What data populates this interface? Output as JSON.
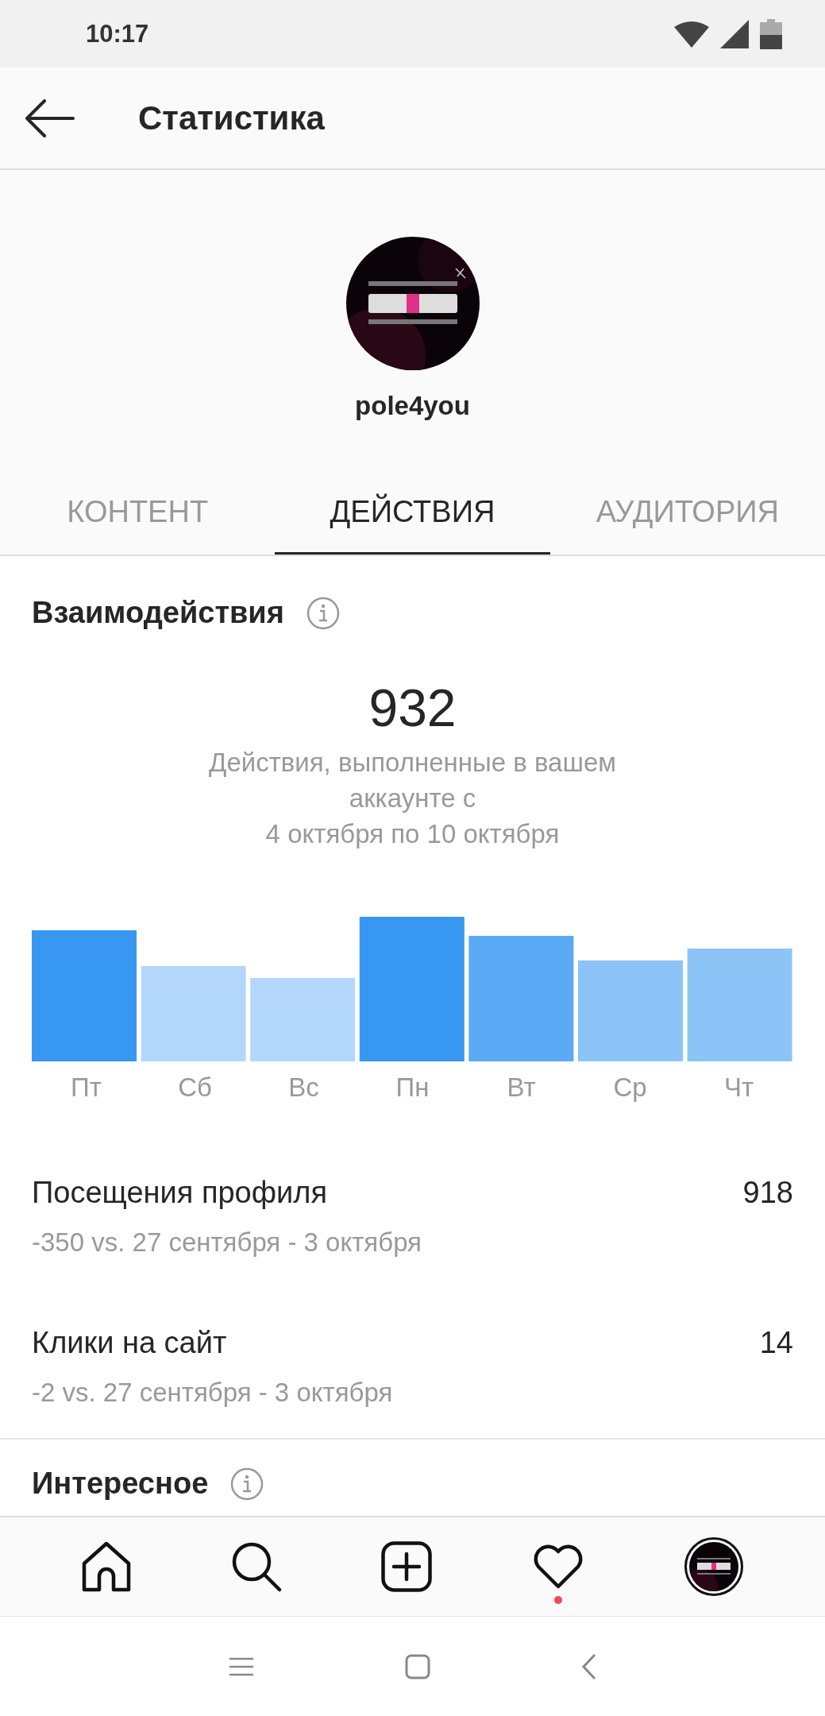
{
  "status_bar": {
    "time": "10:17"
  },
  "header": {
    "title": "Статистика"
  },
  "profile": {
    "username": "pole4you"
  },
  "tabs": [
    {
      "label": "КОНТЕНТ",
      "selected": false
    },
    {
      "label": "ДЕЙСТВИЯ",
      "selected": true
    },
    {
      "label": "АУДИТОРИЯ",
      "selected": false
    }
  ],
  "interactions": {
    "title": "Взаимодействия",
    "total": "932",
    "description": "Действия, выполненные в вашем аккаунте с\n4 октября по 10 октября",
    "days": [
      "Пт",
      "Сб",
      "Вс",
      "Пн",
      "Вт",
      "Ср",
      "Чт"
    ]
  },
  "metrics": [
    {
      "label": "Посещения профиля",
      "value": "918",
      "comparison": "-350 vs. 27 сентября - 3 октября"
    },
    {
      "label": "Клики на сайт",
      "value": "14",
      "comparison": "-2 vs. 27 сентября - 3 октября"
    }
  ],
  "next_section": {
    "title": "Интересное"
  },
  "bottom_nav": {
    "activity_dot": true
  }
}
